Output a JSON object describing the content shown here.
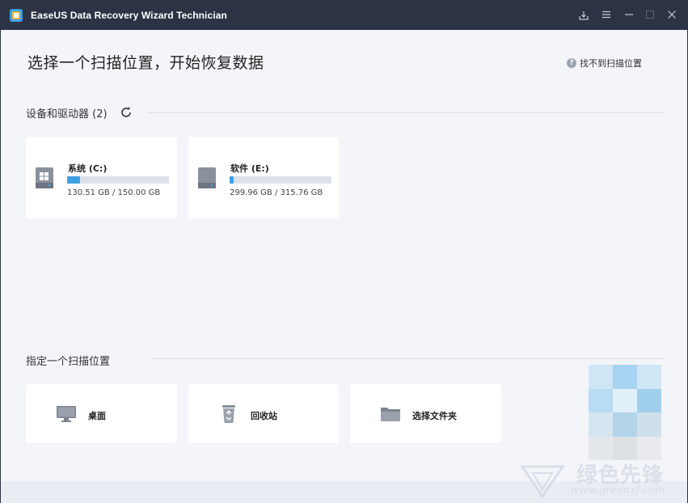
{
  "window": {
    "title": "EaseUS Data Recovery Wizard Technician",
    "controls": [
      "import-icon",
      "menu-icon",
      "minimize-icon",
      "maximize-icon",
      "close-icon"
    ]
  },
  "header": {
    "title": "选择一个扫描位置，开始恢复数据",
    "help_link": "找不到扫描位置"
  },
  "devices": {
    "section_title": "设备和驱动器 (2)",
    "drives": [
      {
        "name": "系统 (C:)",
        "size": "130.51 GB / 150.00 GB",
        "fill_fraction": 0.13,
        "icon": "windows-drive-icon"
      },
      {
        "name": "软件 (E:)",
        "size": "299.96 GB / 315.76 GB",
        "fill_fraction": 0.04,
        "icon": "hard-drive-icon"
      }
    ]
  },
  "locations": {
    "section_title": "指定一个扫描位置",
    "items": [
      {
        "label": "桌面",
        "icon": "desktop-icon"
      },
      {
        "label": "回收站",
        "icon": "recycle-bin-icon"
      },
      {
        "label": "选择文件夹",
        "icon": "folder-icon"
      }
    ]
  },
  "watermark": {
    "text": "绿色先锋",
    "url": "www.greenxf.com"
  },
  "colors": {
    "titlebar": "#2b3344",
    "background": "#f3f5f9",
    "accent": "#3ea0e4"
  }
}
